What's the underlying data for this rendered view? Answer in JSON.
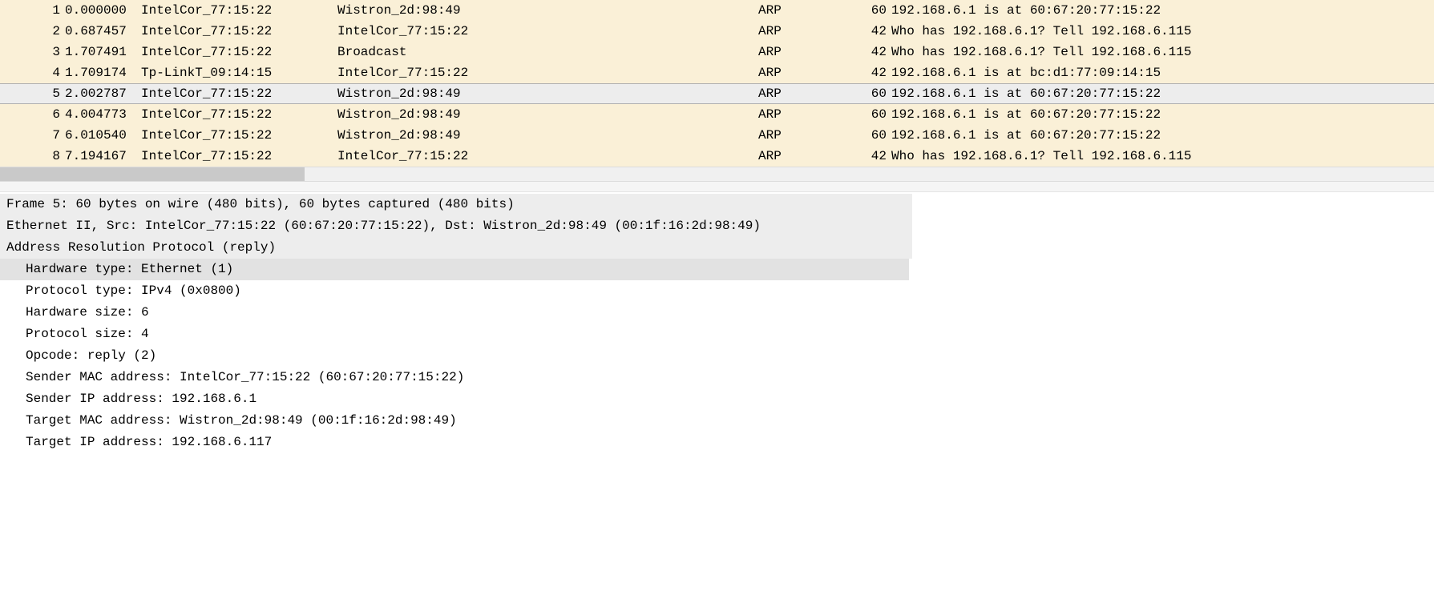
{
  "packets": [
    {
      "no": "1",
      "time": "0.000000",
      "src": "IntelCor_77:15:22",
      "dst": "Wistron_2d:98:49",
      "proto": "ARP",
      "len": "60",
      "info": "192.168.6.1 is at 60:67:20:77:15:22",
      "sel": false
    },
    {
      "no": "2",
      "time": "0.687457",
      "src": "IntelCor_77:15:22",
      "dst": "IntelCor_77:15:22",
      "proto": "ARP",
      "len": "42",
      "info": "Who has 192.168.6.1? Tell 192.168.6.115",
      "sel": false
    },
    {
      "no": "3",
      "time": "1.707491",
      "src": "IntelCor_77:15:22",
      "dst": "Broadcast",
      "proto": "ARP",
      "len": "42",
      "info": "Who has 192.168.6.1? Tell 192.168.6.115",
      "sel": false
    },
    {
      "no": "4",
      "time": "1.709174",
      "src": "Tp-LinkT_09:14:15",
      "dst": "IntelCor_77:15:22",
      "proto": "ARP",
      "len": "42",
      "info": "192.168.6.1 is at bc:d1:77:09:14:15",
      "sel": false
    },
    {
      "no": "5",
      "time": "2.002787",
      "src": "IntelCor_77:15:22",
      "dst": "Wistron_2d:98:49",
      "proto": "ARP",
      "len": "60",
      "info": "192.168.6.1 is at 60:67:20:77:15:22",
      "sel": true
    },
    {
      "no": "6",
      "time": "4.004773",
      "src": "IntelCor_77:15:22",
      "dst": "Wistron_2d:98:49",
      "proto": "ARP",
      "len": "60",
      "info": "192.168.6.1 is at 60:67:20:77:15:22",
      "sel": false
    },
    {
      "no": "7",
      "time": "6.010540",
      "src": "IntelCor_77:15:22",
      "dst": "Wistron_2d:98:49",
      "proto": "ARP",
      "len": "60",
      "info": "192.168.6.1 is at 60:67:20:77:15:22",
      "sel": false
    },
    {
      "no": "8",
      "time": "7.194167",
      "src": "IntelCor_77:15:22",
      "dst": "IntelCor_77:15:22",
      "proto": "ARP",
      "len": "42",
      "info": "Who has 192.168.6.1? Tell 192.168.6.115",
      "sel": false
    }
  ],
  "details": {
    "frame": "Frame 5: 60 bytes on wire (480 bits), 60 bytes captured (480 bits)",
    "eth": "Ethernet II, Src: IntelCor_77:15:22 (60:67:20:77:15:22), Dst: Wistron_2d:98:49 (00:1f:16:2d:98:49)",
    "arp": "Address Resolution Protocol (reply)",
    "fields": {
      "hw_type": "Hardware type: Ethernet (1)",
      "proto_type": "Protocol type: IPv4 (0x0800)",
      "hw_size": "Hardware size: 6",
      "proto_size": "Protocol size: 4",
      "opcode": "Opcode: reply (2)",
      "sender_mac": "Sender MAC address: IntelCor_77:15:22 (60:67:20:77:15:22)",
      "sender_ip": "Sender IP address: 192.168.6.1",
      "target_mac": "Target MAC address: Wistron_2d:98:49 (00:1f:16:2d:98:49)",
      "target_ip": "Target IP address: 192.168.6.117"
    }
  }
}
